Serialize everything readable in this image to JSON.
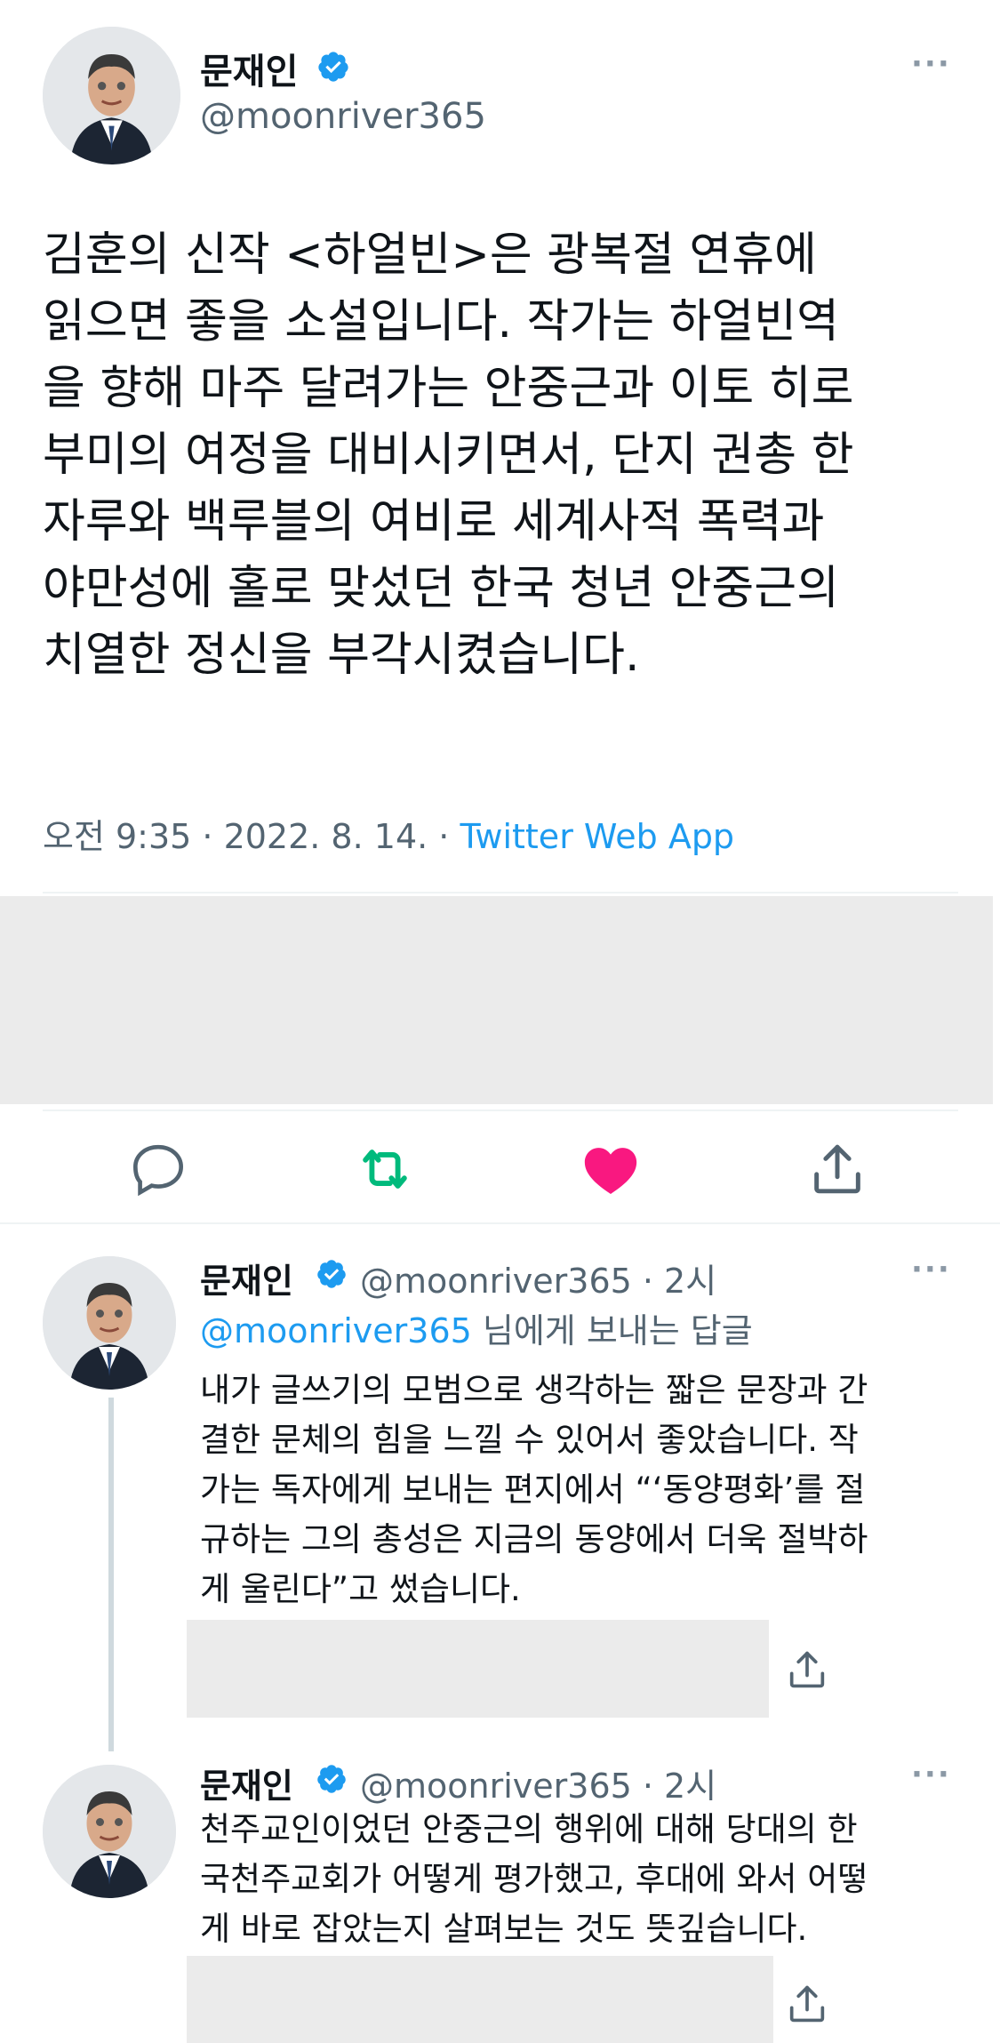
{
  "main_tweet": {
    "name": "문재인",
    "handle": "@moonriver365",
    "more": "···",
    "text_lines": [
      "김훈의 신작 <하얼빈>은 광복절 연휴에",
      "읽으면 좋을 소설입니다. 작가는 하얼빈역",
      "을 향해 마주 달려가는 안중근과 이토 히로",
      "부미의 여정을 대비시키면서, 단지 권총 한",
      "자루와 백루블의 여비로 세계사적 폭력과",
      "야만성에 홀로 맞섰던 한국 청년 안중근의",
      "치열한 정신을 부각시켰습니다."
    ],
    "time": "오전 9:35 · 2022. 8. 14. · ",
    "app": "Twitter Web App"
  },
  "actions": {
    "reply_icon": "comment-icon",
    "retweet_icon": "retweet-icon",
    "like_icon": "heart-icon",
    "share_icon": "share-icon",
    "retweet_color": "#00ba7c",
    "like_color": "#f91880"
  },
  "replies": [
    {
      "name": "문재인",
      "handle": "@moonriver365 · 2시",
      "more": "···",
      "reply_to_handle": "@moonriver365",
      "reply_to_suffix": " 님에게 보내는 답글",
      "text_lines": [
        "내가 글쓰기의 모범으로 생각하는 짧은 문장과 간",
        "결한 문체의 힘을 느낄 수 있어서 좋았습니다. 작",
        "가는 독자에게 보내는 편지에서 “‘동양평화’를 절",
        "규하는 그의 총성은 지금의 동양에서 더욱 절박하",
        "게 울린다”고 썼습니다."
      ]
    },
    {
      "name": "문재인",
      "handle": "@moonriver365 · 2시",
      "more": "···",
      "text_lines": [
        "천주교인이었던 안중근의 행위에 대해 당대의 한",
        "국천주교회가 어떻게 평가했고, 후대에 와서 어떻",
        "게 바로 잡았는지 살펴보는 것도 뜻깊습니다."
      ]
    }
  ],
  "colors": {
    "accent": "#1d9bf0",
    "secondary_text": "#536471",
    "verified": "#1d9bf0"
  }
}
